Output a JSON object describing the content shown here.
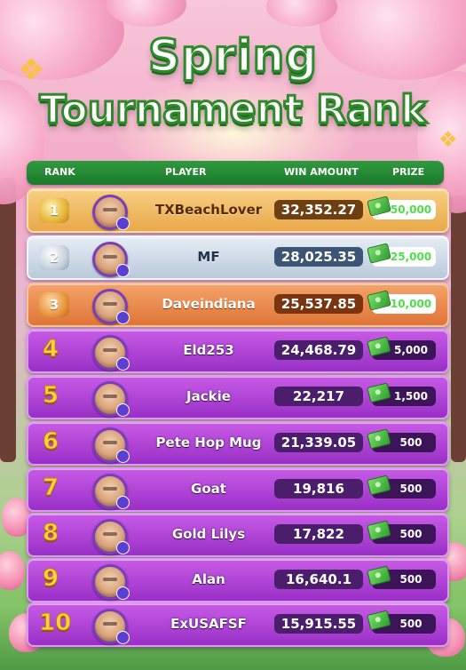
{
  "title": {
    "line1": "Spring",
    "line2": "Tournament Rank"
  },
  "columns": {
    "rank": "RANK",
    "player": "PLAYER",
    "win_amount": "WIN AMOUNT",
    "prize": "PRIZE"
  },
  "rows": [
    {
      "rank": "1",
      "player": "TXBeachLover",
      "win_amount": "32,352.27",
      "prize": "50,000",
      "tier": "gold"
    },
    {
      "rank": "2",
      "player": "MF",
      "win_amount": "28,025.35",
      "prize": "25,000",
      "tier": "silver"
    },
    {
      "rank": "3",
      "player": "Daveindiana",
      "win_amount": "25,537.85",
      "prize": "10,000",
      "tier": "bronze"
    },
    {
      "rank": "4",
      "player": "Eld253",
      "win_amount": "24,468.79",
      "prize": "5,000",
      "tier": "purple"
    },
    {
      "rank": "5",
      "player": "Jackie",
      "win_amount": "22,217",
      "prize": "1,500",
      "tier": "purple"
    },
    {
      "rank": "6",
      "player": "Pete Hop Mug",
      "win_amount": "21,339.05",
      "prize": "500",
      "tier": "purple"
    },
    {
      "rank": "7",
      "player": "Goat",
      "win_amount": "19,816",
      "prize": "500",
      "tier": "purple"
    },
    {
      "rank": "8",
      "player": "Gold Lilys",
      "win_amount": "17,822",
      "prize": "500",
      "tier": "purple"
    },
    {
      "rank": "9",
      "player": "Alan",
      "win_amount": "16,640.1",
      "prize": "500",
      "tier": "purple"
    },
    {
      "rank": "10",
      "player": "ExUSAFSF",
      "win_amount": "15,915.55",
      "prize": "500",
      "tier": "purple"
    }
  ],
  "icons": {
    "prize": "cash-stack-icon",
    "avatar": "player-avatar",
    "medal": "rank-medal-icon"
  },
  "colors": {
    "header": "#1c7a2c",
    "gold": "#e9a84a",
    "silver": "#b9c9da",
    "bronze": "#df7537",
    "purple": "#9a2fc7",
    "prize_text": "#4ee04a"
  }
}
